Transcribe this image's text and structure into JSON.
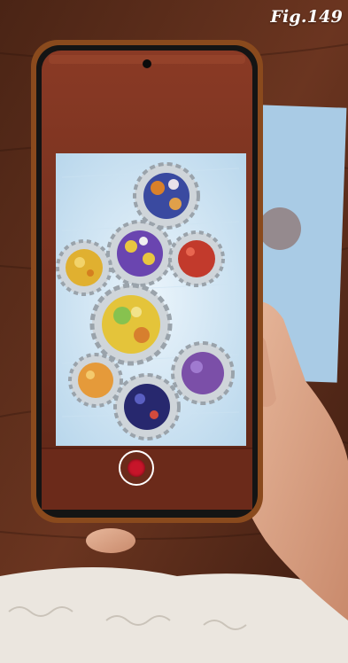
{
  "figure": {
    "label": "Fig.149"
  },
  "camera": {
    "record_label": ""
  },
  "colors": {
    "table": "#5a2c1a",
    "poster": "#d9ebf6",
    "gear": "#cfd5da",
    "record": "#c7152a"
  },
  "icons": [
    "record-icon",
    "gear-icon"
  ]
}
